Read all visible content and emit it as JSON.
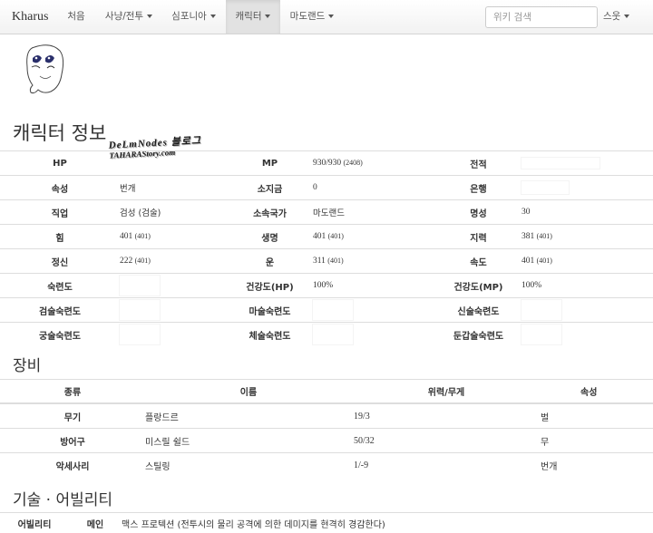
{
  "navbar": {
    "brand": "Kharus",
    "items": [
      {
        "label": "처음",
        "dropdown": false,
        "active": false
      },
      {
        "label": "사냥/전투",
        "dropdown": true,
        "active": false
      },
      {
        "label": "심포니아",
        "dropdown": true,
        "active": false
      },
      {
        "label": "캐릭터",
        "dropdown": true,
        "active": true
      },
      {
        "label": "마도랜드",
        "dropdown": true,
        "active": false
      }
    ],
    "search_placeholder": "위키 검색",
    "user": "스웃"
  },
  "character": {
    "title": "캐릭터 정보",
    "watermark": [
      "DeLmNodes 블로그",
      "TAHARAStory.com"
    ],
    "rows": [
      [
        {
          "k": "HP",
          "v": ""
        },
        {
          "k": "MP",
          "v": "930/930",
          "sub": "(2408)"
        },
        {
          "k": "전적",
          "v": "",
          "masked": true
        }
      ],
      [
        {
          "k": "속성",
          "v": "번개"
        },
        {
          "k": "소지금",
          "v": "0"
        },
        {
          "k": "은행",
          "v": "",
          "masked": true
        }
      ],
      [
        {
          "k": "직업",
          "v": "검성 (검술)"
        },
        {
          "k": "소속국가",
          "v": "마도랜드"
        },
        {
          "k": "명성",
          "v": "30"
        }
      ],
      [
        {
          "k": "힘",
          "v": "401",
          "sub": "(401)"
        },
        {
          "k": "생명",
          "v": "401",
          "sub": "(401)"
        },
        {
          "k": "지력",
          "v": "381",
          "sub": "(401)"
        }
      ],
      [
        {
          "k": "정신",
          "v": "222",
          "sub": "(401)"
        },
        {
          "k": "운",
          "v": "311",
          "sub": "(401)"
        },
        {
          "k": "속도",
          "v": "401",
          "sub": "(401)"
        }
      ],
      [
        {
          "k": "숙련도",
          "v": "",
          "masked": true
        },
        {
          "k": "건강도(HP)",
          "v": "100%"
        },
        {
          "k": "건강도(MP)",
          "v": "100%"
        }
      ],
      [
        {
          "k": "검술숙련도",
          "v": "",
          "masked": true
        },
        {
          "k": "마술숙련도",
          "v": "",
          "masked": true
        },
        {
          "k": "신술숙련도",
          "v": "",
          "masked": true
        }
      ],
      [
        {
          "k": "궁술숙련도",
          "v": "",
          "masked": true
        },
        {
          "k": "체술숙련도",
          "v": "",
          "masked": true
        },
        {
          "k": "둔갑술숙련도",
          "v": "",
          "masked": true
        }
      ]
    ]
  },
  "equipment": {
    "title": "장비",
    "headers": [
      "종류",
      "이름",
      "위력/무게",
      "속성"
    ],
    "rows": [
      {
        "type": "무기",
        "name": "플랑드르",
        "power": "19/3",
        "attr": "벌"
      },
      {
        "type": "방어구",
        "name": "미스릴 쉴드",
        "power": "50/32",
        "attr": "무"
      },
      {
        "type": "악세사리",
        "name": "스틸링",
        "power": "1/-9",
        "attr": "번개"
      }
    ]
  },
  "skills": {
    "title": "기술 · 어빌리티",
    "rows": [
      {
        "category": "어빌리티",
        "name": "메인",
        "desc": "맥스 프로텍션 (전투시의 물리 공격에 의한 데미지를 현격히 경감한다)"
      }
    ]
  }
}
